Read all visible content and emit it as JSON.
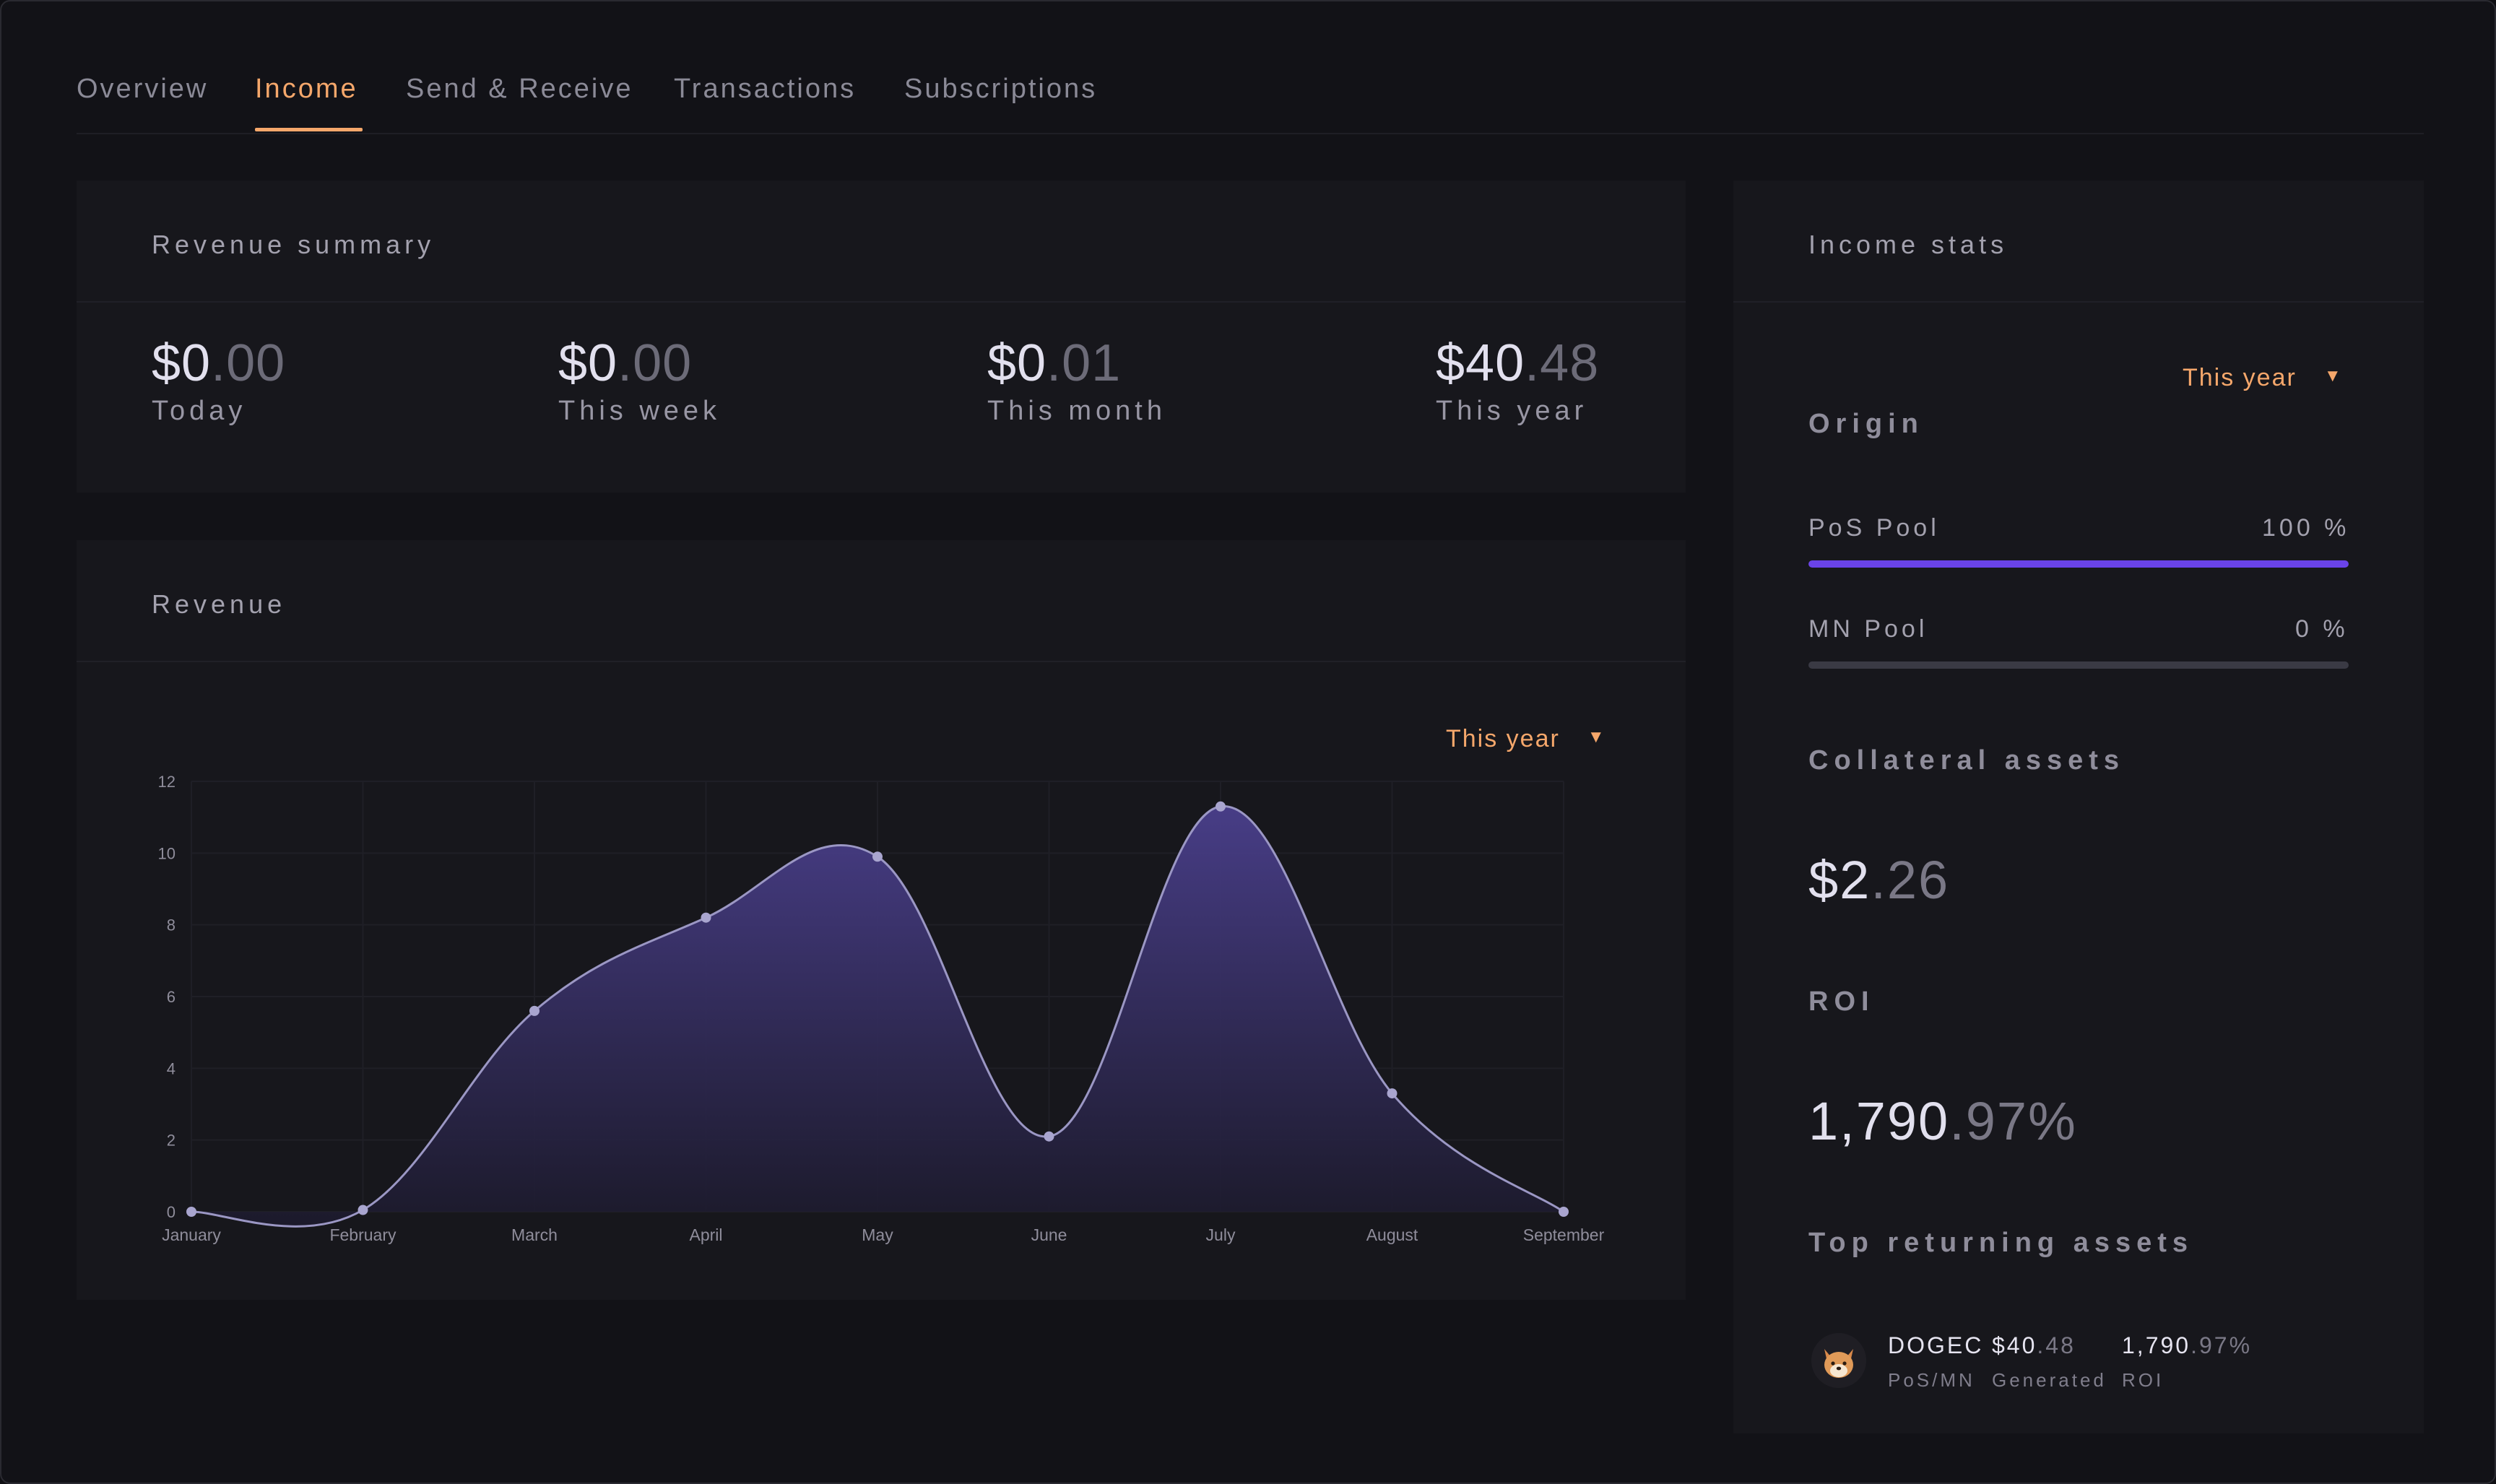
{
  "tabs": [
    {
      "label": "Overview",
      "active": false
    },
    {
      "label": "Income",
      "active": true
    },
    {
      "label": "Send & Receive",
      "active": false
    },
    {
      "label": "Transactions",
      "active": false
    },
    {
      "label": "Subscriptions",
      "active": false
    }
  ],
  "revenue_summary": {
    "title": "Revenue summary",
    "items": [
      {
        "whole": "$0",
        "decimal": ".00",
        "label": "Today"
      },
      {
        "whole": "$0",
        "decimal": ".00",
        "label": "This week"
      },
      {
        "whole": "$0",
        "decimal": ".01",
        "label": "This month"
      },
      {
        "whole": "$40",
        "decimal": ".48",
        "label": "This year"
      }
    ]
  },
  "revenue_chart": {
    "title": "Revenue",
    "period": "This year",
    "caret": "▼"
  },
  "income_stats": {
    "title": "Income stats",
    "period": "This year",
    "caret": "▼",
    "origin_label": "Origin",
    "pools": [
      {
        "name": "PoS Pool",
        "percent_text": "100 %",
        "fraction": 1.0,
        "color": "#6a43e8"
      },
      {
        "name": "MN Pool",
        "percent_text": "0 %",
        "fraction": 0.0,
        "color": "#6a43e8"
      }
    ],
    "collateral_label": "Collateral assets",
    "collateral": {
      "whole": "$2",
      "decimal": ".26"
    },
    "roi_label": "ROI",
    "roi": {
      "whole": "1,790",
      "decimal": ".97%"
    },
    "top_assets_label": "Top returning assets",
    "top_assets": [
      {
        "icon": "dogecoin-shiba-icon",
        "name": "DOGEC",
        "type": "PoS/MN",
        "generated_whole": "$40",
        "generated_decimal": ".48",
        "generated_label": "Generated",
        "roi_whole": "1,790",
        "roi_decimal": ".97%",
        "roi_label": "ROI"
      }
    ]
  },
  "colors": {
    "accent": "#f5a76b",
    "bar_fill": "#6a43e8",
    "line": "#9b97c4",
    "area_top": "#4a3f8c",
    "background": "#121217",
    "card": "#17171c"
  },
  "chart_data": {
    "type": "area",
    "categories": [
      "January",
      "February",
      "March",
      "April",
      "May",
      "June",
      "July",
      "August",
      "September"
    ],
    "values": [
      0,
      0.05,
      5.6,
      8.2,
      9.9,
      2.1,
      11.3,
      3.3,
      0
    ],
    "yticks": [
      0,
      2,
      4,
      6,
      8,
      10,
      12
    ],
    "ylim": [
      0,
      12
    ],
    "grid": true,
    "legend": false,
    "title": "Revenue"
  }
}
